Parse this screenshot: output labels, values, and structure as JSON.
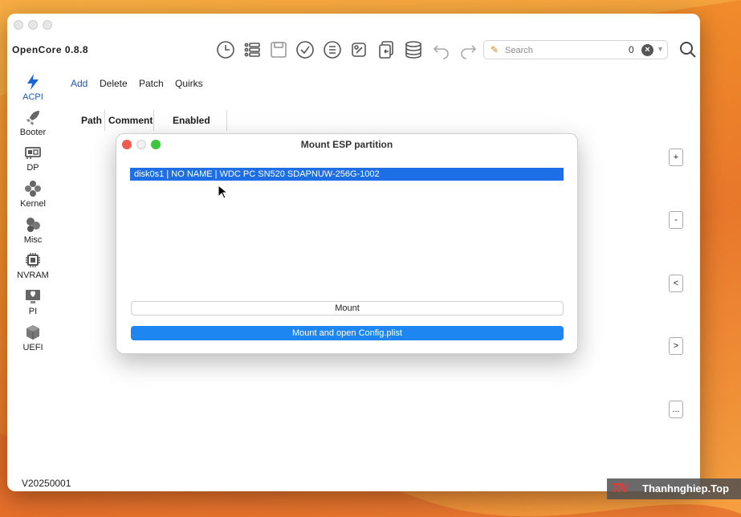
{
  "app": {
    "title": "OpenCore 0.8.8",
    "version": "V20250001"
  },
  "search": {
    "placeholder": "Search",
    "count": "0"
  },
  "sidebar": {
    "items": [
      {
        "label": "ACPI",
        "icon": "bolt-icon",
        "active": true
      },
      {
        "label": "Booter",
        "icon": "rocket-icon"
      },
      {
        "label": "DP",
        "icon": "graphics-card-icon"
      },
      {
        "label": "Kernel",
        "icon": "kernel-icon"
      },
      {
        "label": "Misc",
        "icon": "misc-icon"
      },
      {
        "label": "NVRAM",
        "icon": "chip-icon"
      },
      {
        "label": "PI",
        "icon": "platform-icon"
      },
      {
        "label": "UEFI",
        "icon": "cube-icon"
      }
    ]
  },
  "tabs": [
    "Add",
    "Delete",
    "Patch",
    "Quirks"
  ],
  "table": {
    "columns": [
      "Path",
      "Comment",
      "Enabled"
    ]
  },
  "side_buttons": [
    "+",
    "-",
    "<",
    ">",
    "..."
  ],
  "dialog": {
    "title": "Mount ESP partition",
    "rows": [
      "disk0s1 | NO NAME | WDC PC SN520 SDAPNUW-256G-1002"
    ],
    "mount_label": "Mount",
    "mount_open_label": "Mount and open Config.plist"
  },
  "watermark": {
    "logo": "TN",
    "text": "Thanhnghiep.Top"
  },
  "colors": {
    "accent": "#1a56c4",
    "selection": "#1e6fe6",
    "primary_button": "#1e86f0",
    "close_red": "#ee5d50",
    "minimize_yellow": "#f5c24c",
    "zoom_green": "#3ec53e"
  }
}
